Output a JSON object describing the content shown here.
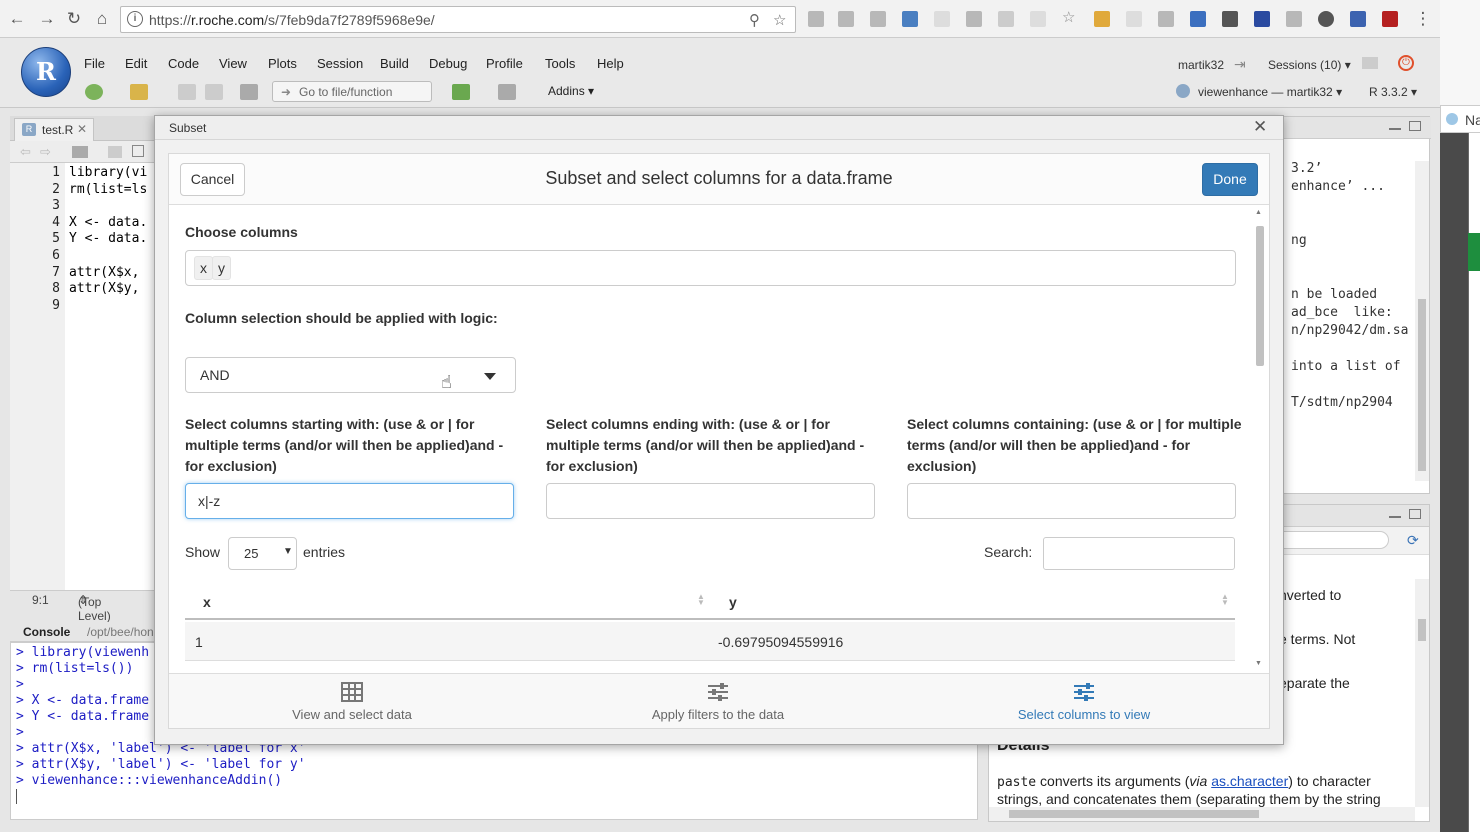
{
  "browser": {
    "url_prefix": "https://",
    "url_host": "r.roche.com",
    "url_path": "/s/7feb9da7f2789f5968e9e/",
    "right_tab_partial": "Na"
  },
  "menubar": {
    "items": [
      "File",
      "Edit",
      "Code",
      "View",
      "Plots",
      "Session",
      "Build",
      "Debug",
      "Profile",
      "Tools",
      "Help"
    ],
    "goto_placeholder": "Go to file/function",
    "addins": "Addins",
    "user": "martik32",
    "sessions": "Sessions (10)",
    "project": "viewenhance — martik32",
    "r_version": "R 3.3.2"
  },
  "editor": {
    "tab_label": "test.R",
    "lines": [
      "1",
      "2",
      "3",
      "4",
      "5",
      "6",
      "7",
      "8",
      "9"
    ],
    "code": [
      "library(vi",
      "rm(list=ls",
      "",
      "X <- data.",
      "Y <- data.",
      "",
      "attr(X$x,",
      "attr(X$y,",
      ""
    ],
    "cursor_pos": "9:1",
    "scope": "(Top Level)"
  },
  "console": {
    "title": "Console",
    "path": "/opt/bee/hon",
    "lines": [
      "> library(viewenh",
      "> rm(list=ls())",
      ">",
      "> X <- data.frame",
      "> Y <- data.frame",
      ">",
      "> attr(X$x, 'label') <- 'label for x'",
      "> attr(X$y, 'label') <- 'label for y'",
      "> viewenhance:::viewenhanceAddin()"
    ]
  },
  "right_output": {
    "lines": [
      "3.2’",
      "enhance’ ...",
      "",
      "",
      "ng",
      "",
      "",
      "n be loaded",
      "ad_bce  like:",
      "n/np29042/dm.sa",
      "",
      "into a list of",
      "",
      "T/sdtm/np2904"
    ]
  },
  "help": {
    "lines": [
      "nverted to",
      "e terms. Not",
      "eparate the"
    ],
    "details_heading": "Details",
    "para_code": "paste",
    "para_text1": " converts its arguments (",
    "para_via": "via",
    "para_link": "as.character",
    "para_text2": ") to character strings, and concatenates them (separating them by the string"
  },
  "modal": {
    "window_title": "Subset",
    "heading": "Subset and select columns for a data.frame",
    "cancel_label": "Cancel",
    "done_label": "Done",
    "choose_columns_label": "Choose columns",
    "selected_columns": [
      "x",
      "y"
    ],
    "logic_label": "Column selection should be applied with logic:",
    "logic_value": "AND",
    "starts_with_label": "Select columns starting with: (use & or | for multiple terms (and/or will then be applied)and - for exclusion)",
    "starts_with_value": "x|-z",
    "ends_with_label": "Select columns ending with: (use & or | for multiple terms (and/or will then be applied)and - for exclusion)",
    "ends_with_value": "",
    "contains_label": "Select columns containing: (use & or | for multiple terms (and/or will then be applied)and - for exclusion)",
    "contains_value": "",
    "show_label": "Show",
    "entries_value": "25",
    "entries_label": "entries",
    "search_label": "Search:",
    "table": {
      "columns": [
        "x",
        "y"
      ],
      "rows": [
        [
          "1",
          "-0.69795094559916"
        ]
      ]
    },
    "bottom_tabs": [
      {
        "label": "View and select data",
        "icon": "table-icon",
        "active": false
      },
      {
        "label": "Apply filters to the data",
        "icon": "sliders-icon",
        "active": false
      },
      {
        "label": "Select columns to view",
        "icon": "sliders-icon",
        "active": true
      }
    ]
  },
  "colors": {
    "primary": "#337ab7",
    "focus": "#66afe9",
    "console_text": "#1c1cc4"
  }
}
